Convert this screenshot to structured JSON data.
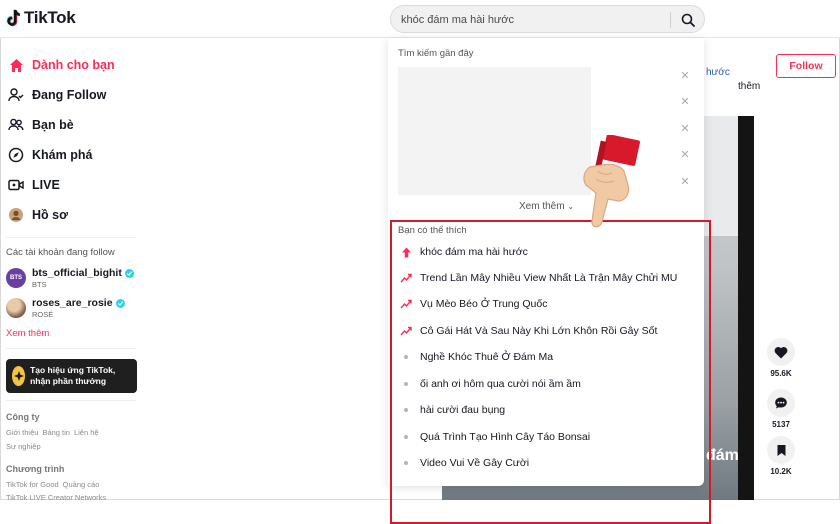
{
  "header": {
    "logo_text": "TikTok",
    "search_value": "khóc đám ma hài hước"
  },
  "sidebar": {
    "nav": [
      {
        "label": "Dành cho bạn",
        "icon": "home-icon",
        "active": true
      },
      {
        "label": "Đang Follow",
        "icon": "following-icon",
        "active": false
      },
      {
        "label": "Bạn bè",
        "icon": "friends-icon",
        "active": false
      },
      {
        "label": "Khám phá",
        "icon": "explore-icon",
        "active": false
      },
      {
        "label": "LIVE",
        "icon": "live-icon",
        "active": false
      },
      {
        "label": "Hồ sơ",
        "icon": "profile-icon",
        "active": false
      }
    ],
    "following_title": "Các tài khoản đang follow",
    "accounts": [
      {
        "name": "bts_official_bighit",
        "sub": "BTS",
        "avatar_text": "BTS"
      },
      {
        "name": "roses_are_rosie",
        "sub": "ROSÉ"
      }
    ],
    "see_more": "Xem thêm",
    "effect_banner": "Tạo hiệu ứng TikTok, nhận phần thưởng",
    "footer": {
      "company_title": "Công ty",
      "company_links": [
        "Giới thiệu",
        "Bảng tin",
        "Liên hệ"
      ],
      "company_links2": [
        "Sự nghiệp"
      ],
      "program_title": "Chương trình",
      "program_links": [
        "TikTok for Good",
        "Quảng cáo"
      ],
      "program_links2": [
        "TikTok LIVE Creator Networks"
      ]
    }
  },
  "dropdown": {
    "recent_title": "Tìm kiếm gần đây",
    "see_more": "Xem thêm",
    "suggest_title": "Bạn có thể thích",
    "suggestions": [
      {
        "text": "khóc đám ma hài hước",
        "kind": "hot"
      },
      {
        "text": "Trend Lần Mây Nhiều View Nhất Là Trận Mây Chửi MU",
        "kind": "trending"
      },
      {
        "text": "Vụ Mèo Béo Ở Trung Quốc",
        "kind": "trending"
      },
      {
        "text": "Cô Gái Hát Và Sau Này Khi Lớn Khôn Rồi Gây Sốt",
        "kind": "trending"
      },
      {
        "text": "Nghề Khóc Thuê Ở Đám Ma",
        "kind": "normal"
      },
      {
        "text": "ối anh ơi hôm qua cười nói ầm ầm",
        "kind": "normal"
      },
      {
        "text": "hài cười đau bụng",
        "kind": "normal"
      },
      {
        "text": "Quá Trình Tạo Hình Cây Táo Bonsai",
        "kind": "normal"
      },
      {
        "text": "Video Vui Về Gây Cười",
        "kind": "normal"
      }
    ]
  },
  "main": {
    "author_fragment": "hước",
    "more_fragment": "thêm",
    "follow_label": "Follow",
    "caption_fragment": "đám",
    "actions": [
      {
        "icon": "heart-icon",
        "count": "95.6K"
      },
      {
        "icon": "comment-icon",
        "count": "5137"
      },
      {
        "icon": "bookmark-icon",
        "count": "10.2K"
      }
    ]
  },
  "colors": {
    "brand_red": "#fe2c55",
    "highlight_box": "#d11b2a"
  }
}
